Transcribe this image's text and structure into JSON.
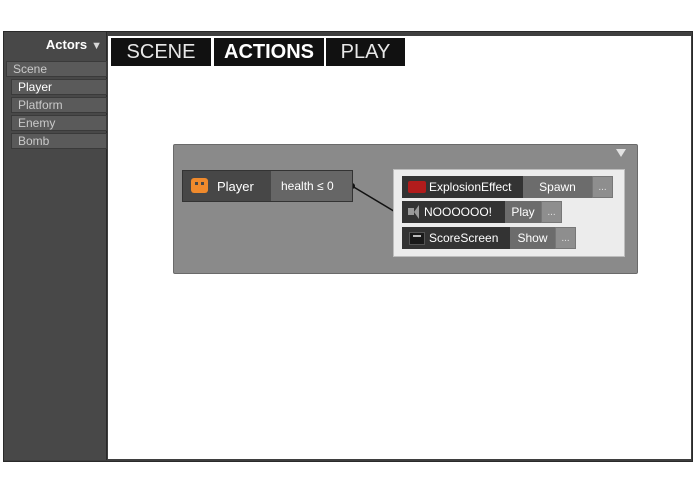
{
  "sidebar": {
    "title": "Actors",
    "items": [
      {
        "label": "Scene",
        "selected": false
      },
      {
        "label": "Player",
        "selected": true
      },
      {
        "label": "Platform",
        "selected": false
      },
      {
        "label": "Enemy",
        "selected": false
      },
      {
        "label": "Bomb",
        "selected": false
      }
    ]
  },
  "tabs": [
    {
      "label": "SCENE",
      "active": false
    },
    {
      "label": "ACTIONS",
      "active": true
    },
    {
      "label": "PLAY",
      "active": false
    }
  ],
  "rule": {
    "trigger": {
      "actor": "Player",
      "icon": "player-face-icon",
      "condition": "health ≤ 0"
    },
    "actions": [
      {
        "name": "ExplosionEffect",
        "icon": "red-effect-icon",
        "verb": "Spawn",
        "more": "..."
      },
      {
        "name": "NOOOOOO!",
        "icon": "speaker-icon",
        "verb": "Play",
        "more": "..."
      },
      {
        "name": "ScoreScreen",
        "icon": "screen-icon",
        "verb": "Show",
        "more": "..."
      }
    ]
  },
  "colors": {
    "player_icon": "#f08a2c",
    "effect_icon": "#b21c1c",
    "sidebar_bg": "#484848",
    "panel_bg": "#8a8a8a",
    "tab_bg": "#111111"
  }
}
